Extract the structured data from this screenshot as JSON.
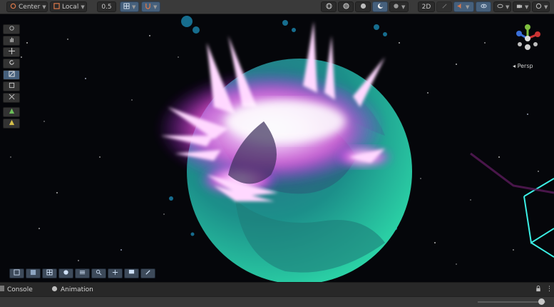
{
  "toolbar": {
    "pivot_mode": "Center",
    "pivot_rotation": "Local",
    "snap_value": "0.5",
    "mode_2d": "2D"
  },
  "scene": {
    "camera_label": "Persp",
    "gizmo_icon": "axis-gizmo-icon"
  },
  "colors": {
    "glow": "#ff66ee",
    "planet": "#1fa8a0",
    "active_button": "#46607c"
  },
  "tabs": {
    "console": "Console",
    "animation": "Animation"
  }
}
